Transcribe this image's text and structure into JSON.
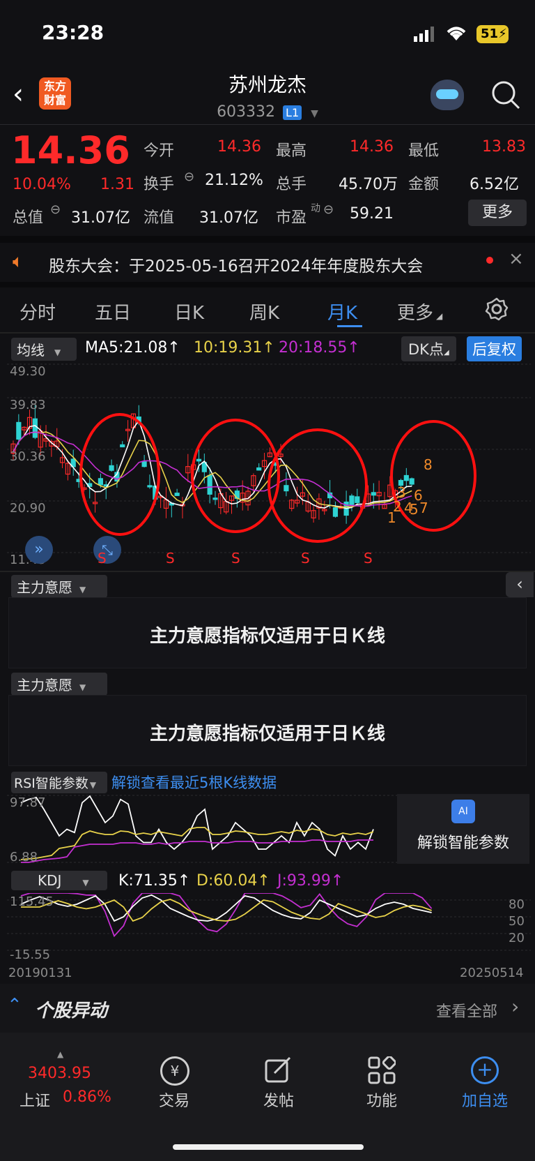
{
  "status_bar": {
    "time": "23:28",
    "battery": "51"
  },
  "header": {
    "logo_line1": "东方",
    "logo_line2": "财富",
    "stock_name": "苏州龙杰",
    "stock_code": "603332",
    "level_badge": "L1"
  },
  "quote": {
    "price": "14.36",
    "change_pct": "10.04%",
    "change_amt": "1.31",
    "open_label": "今开",
    "open": "14.36",
    "high_label": "最高",
    "high": "14.36",
    "low_label": "最低",
    "low": "13.83",
    "turnover_label": "换手",
    "turnover": "21.12%",
    "volume_label": "总手",
    "volume": "45.70万",
    "amount_label": "金额",
    "amount": "6.52亿",
    "mcap_label": "总值",
    "mcap": "31.07亿",
    "float_label": "流值",
    "float_cap": "31.07亿",
    "pe_label": "市盈",
    "pe_super": "动",
    "pe": "59.21",
    "more_label": "更多"
  },
  "notice": {
    "text": "股东大会：于2025-05-16召开2024年年度股东大会"
  },
  "tabs": [
    "分时",
    "五日",
    "日K",
    "周K",
    "月K",
    "更多"
  ],
  "active_tab": "月K",
  "ma_bar": {
    "selector": "均线",
    "ma5": "MA5:21.08↑",
    "ma10": "10:19.31↑",
    "ma20": "20:18.55↑",
    "dk_label": "DK点",
    "adjust_label": "后复权"
  },
  "kline": {
    "y_ticks": [
      "49.30",
      "39.83",
      "30.36",
      "20.90",
      "11.43"
    ],
    "s_marks": [
      "S",
      "S",
      "S",
      "S",
      "S"
    ],
    "dk_numbers": [
      "1",
      "2",
      "3",
      "4",
      "5",
      "6",
      "7",
      "8"
    ]
  },
  "indicator1": {
    "selector": "主力意愿",
    "message": "主力意愿指标仅适用于日Ｋ线"
  },
  "indicator2": {
    "selector": "主力意愿",
    "message": "主力意愿指标仅适用于日Ｋ线"
  },
  "rsi": {
    "selector": "RSI智能参数",
    "unlock_link": "解锁查看最近5根K线数据",
    "y_ticks": [
      "97.87",
      "6.88"
    ],
    "unlock_button": "解锁智能参数"
  },
  "kdj": {
    "selector": "KDJ",
    "k": "K:71.35↑",
    "d": "D:60.04↑",
    "j": "J:93.99↑",
    "y_ticks": [
      "115.45",
      "-15.55"
    ],
    "right_ticks": [
      "80",
      "50",
      "20"
    ],
    "date_start": "20190131",
    "date_end": "20250514"
  },
  "movers": {
    "title": "个股异动",
    "view_all": "查看全部"
  },
  "bottom_nav": {
    "index_value": "3403.95",
    "index_name": "上证",
    "index_change": "0.86%",
    "trade": "交易",
    "post": "发帖",
    "function": "功能",
    "add_watch": "加自选"
  },
  "colors": {
    "up": "#ff2a2a",
    "down": "#2ed3d3",
    "ma5": "#ffffff",
    "ma10": "#e8d24a",
    "ma20": "#c42fd1",
    "accent": "#2a7ee0"
  }
}
